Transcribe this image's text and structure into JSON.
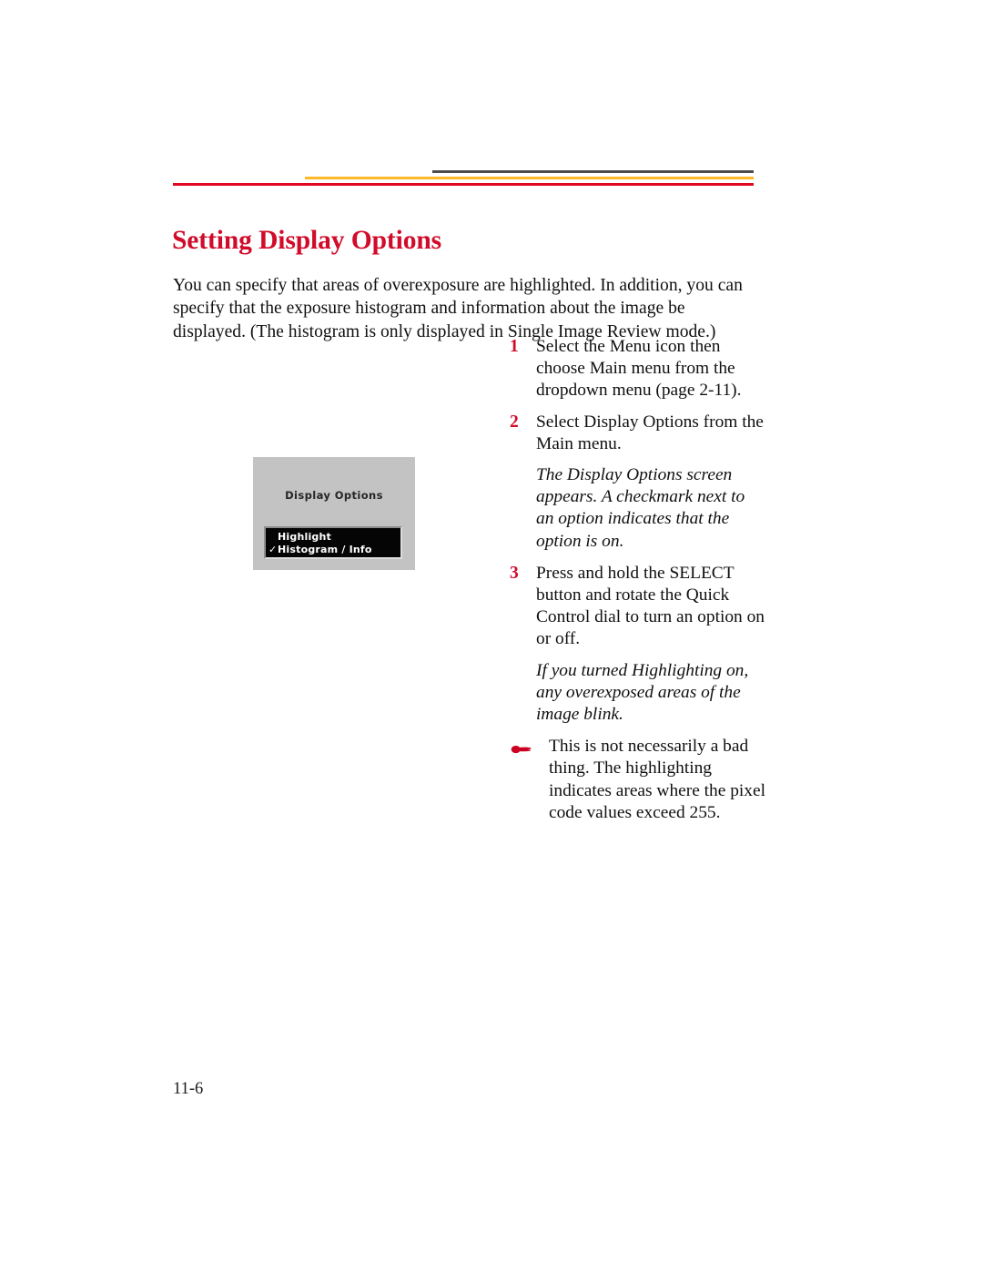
{
  "header": {
    "rules": [
      {
        "name": "gray",
        "color": "#4d4d4d"
      },
      {
        "name": "orange",
        "color": "#fdb827"
      },
      {
        "name": "red",
        "color": "#e1081f"
      }
    ]
  },
  "page_title": "Setting Display Options",
  "title_color": "#d10b2a",
  "intro": "You can specify that areas of overexposure are highlighted. In addition, you can specify that the exposure histogram and information about the image be displayed. (The histogram is only displayed in Single Image Review mode.)",
  "figure": {
    "caption_title": "Display Options",
    "menu_items": [
      {
        "checkmark": "",
        "label": "Highlight"
      },
      {
        "checkmark": "✓",
        "label": "Histogram / Info"
      }
    ]
  },
  "steps": [
    {
      "number": "1",
      "text": "Select the Menu icon then choose Main menu from the dropdown menu (page 2-11)."
    },
    {
      "number": "2",
      "text": "Select Display Options from the Main menu."
    },
    {
      "number": "3",
      "text": "Press and hold the SELECT button and rotate the Quick Control dial to turn an option on or off."
    }
  ],
  "notes": {
    "note_1": "The Display Options screen appears. A checkmark next to an option indicates that the option is on.",
    "note_2": "If you turned Highlighting on, any overexposed areas of the image blink."
  },
  "tip": {
    "icon": "pointing-hand",
    "icon_color": "#cc0022",
    "text": "This is not necessarily a bad thing. The highlighting indicates areas where the pixel code values exceed 255."
  },
  "folio": "11-6"
}
